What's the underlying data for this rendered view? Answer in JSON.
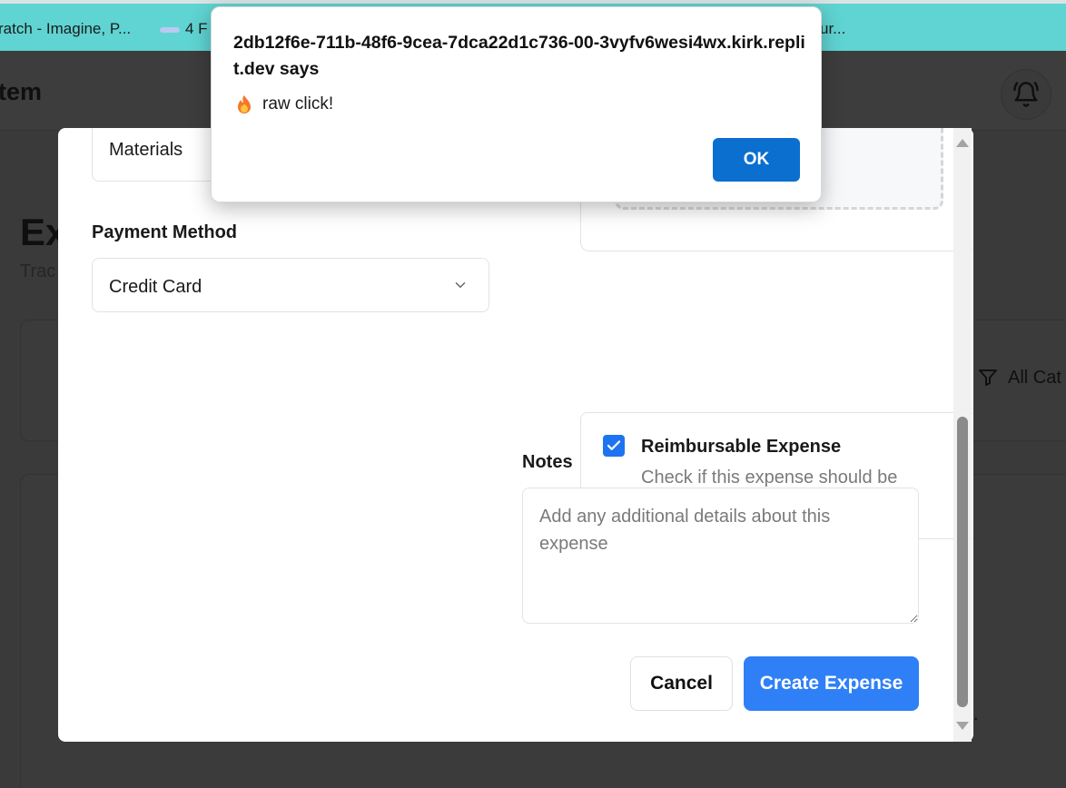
{
  "browser": {
    "bookmarks": [
      {
        "label": "ratch - Imagine, P..."
      },
      {
        "label": "4 F"
      },
      {
        "label": "ur..."
      }
    ]
  },
  "background_app": {
    "title": "tem",
    "heading": "Ex",
    "subheading": "Trac",
    "filter_label": "All Cat",
    "trailing_text": "."
  },
  "modal": {
    "category_value": "Materials",
    "payment_method_label": "Payment Method",
    "payment_method_value": "Credit Card",
    "reimbursable": {
      "title": "Reimbursable Expense",
      "description": "Check if this expense should be reimbursed to an employee",
      "checked": true
    },
    "notes": {
      "label": "Notes",
      "placeholder": "Add any additional details about this expense",
      "value": ""
    },
    "cancel_label": "Cancel",
    "create_label": "Create Expense"
  },
  "alert": {
    "origin": "2db12f6e-711b-48f6-9cea-7dca22d1c736-00-3vyfv6wesi4wx.kirk.replit.dev says",
    "message_icon": "fire-icon",
    "message": "raw click!",
    "ok_label": "OK"
  },
  "colors": {
    "primary": "#2f80f7",
    "alert_ok": "#0b6fd0",
    "bookmarks_bar": "#5fd4d2"
  }
}
